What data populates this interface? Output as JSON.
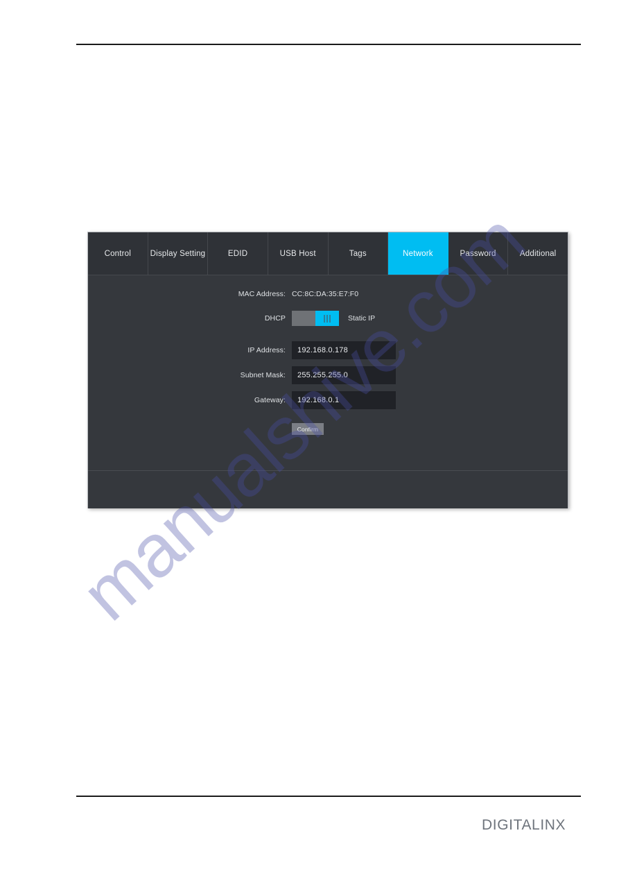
{
  "document": {
    "brand_logo_text": "DIGITALINX",
    "watermark_text": "manualshive.com"
  },
  "colors": {
    "accent_cyan": "#00BDF2",
    "panel_background": "#35383D",
    "tab_background": "#2F3237",
    "input_background": "#202227",
    "toggle_off": "#6F7276",
    "button_gray": "#7B7E85",
    "text_light": "#DFE2E5"
  },
  "ui_panel": {
    "tabs": [
      {
        "label": "Control",
        "active": false
      },
      {
        "label": "Display Setting",
        "active": false
      },
      {
        "label": "EDID",
        "active": false
      },
      {
        "label": "USB Host",
        "active": false
      },
      {
        "label": "Tags",
        "active": false
      },
      {
        "label": "Network",
        "active": true
      },
      {
        "label": "Password",
        "active": false
      },
      {
        "label": "Additional",
        "active": false
      }
    ],
    "network": {
      "mac_label": "MAC Address:",
      "mac_value": "CC:8C:DA:35:E7:F0",
      "dhcp_label": "DHCP",
      "static_ip_label": "Static IP",
      "toggle_state": "static",
      "ip_label": "IP Address:",
      "ip_value": "192.168.0.178",
      "subnet_label": "Subnet Mask:",
      "subnet_value": "255.255.255.0",
      "gateway_label": "Gateway:",
      "gateway_value": "192.168.0.1",
      "confirm_label": "Confirm"
    }
  }
}
